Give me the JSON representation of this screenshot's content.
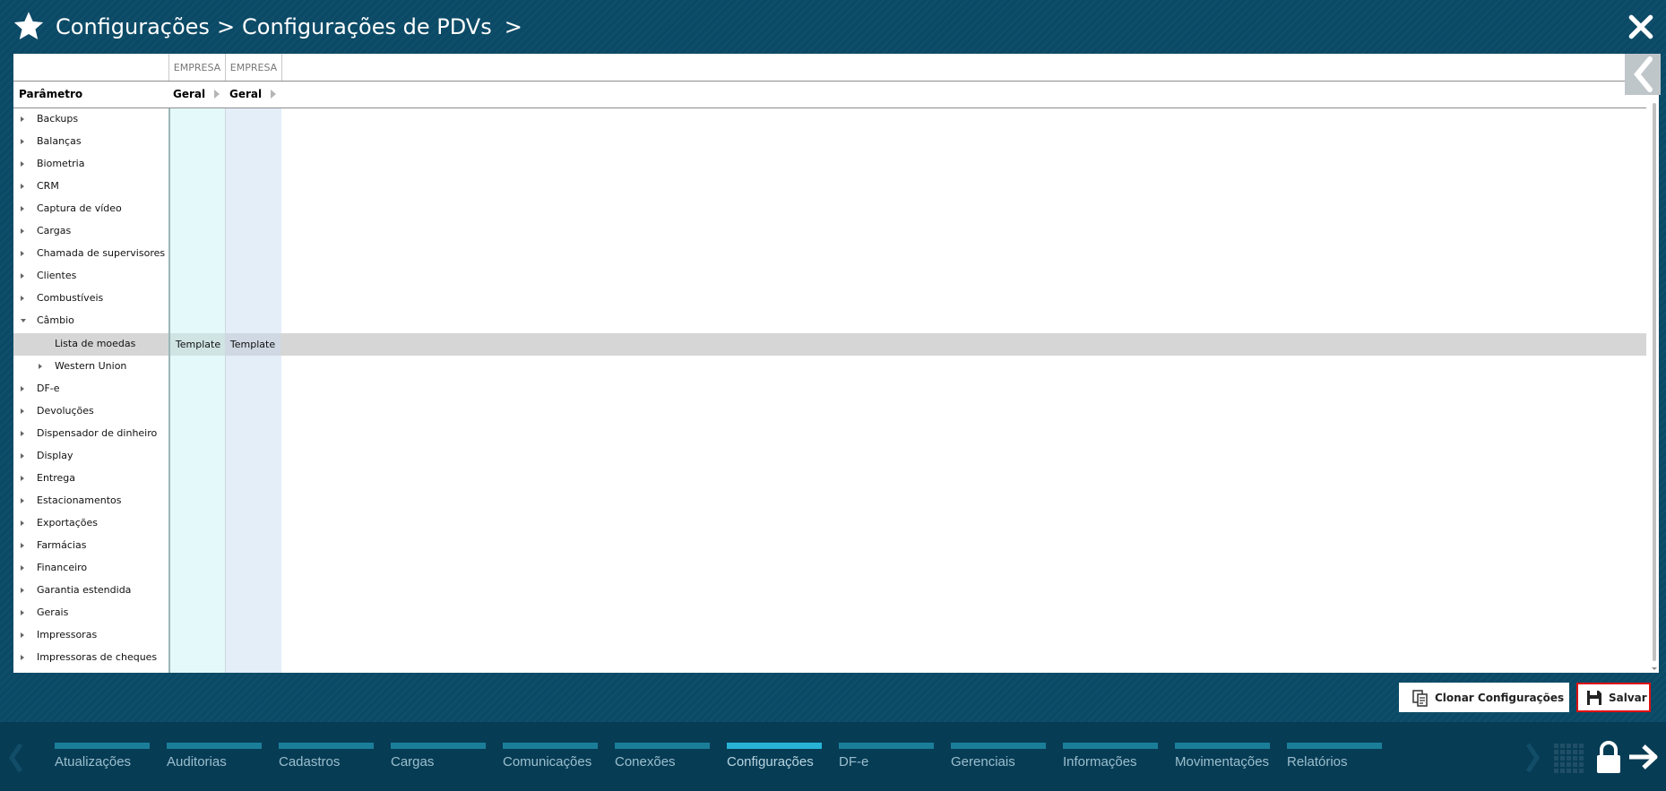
{
  "header": {
    "breadcrumb": [
      "Configurações",
      "Configurações de PDVs"
    ],
    "separator": ">"
  },
  "grid": {
    "columns": [
      {
        "type": "EMPRESA",
        "name": "Geral"
      },
      {
        "type": "EMPRESA",
        "name": "Geral"
      }
    ],
    "param_header": "Parâmetro",
    "rows": [
      {
        "label": "Backups",
        "level": 0,
        "state": "collapsed"
      },
      {
        "label": "Balanças",
        "level": 0,
        "state": "collapsed"
      },
      {
        "label": "Biometria",
        "level": 0,
        "state": "collapsed"
      },
      {
        "label": "CRM",
        "level": 0,
        "state": "collapsed"
      },
      {
        "label": "Captura de vídeo",
        "level": 0,
        "state": "collapsed"
      },
      {
        "label": "Cargas",
        "level": 0,
        "state": "collapsed"
      },
      {
        "label": "Chamada de supervisores",
        "level": 0,
        "state": "collapsed"
      },
      {
        "label": "Clientes",
        "level": 0,
        "state": "collapsed"
      },
      {
        "label": "Combustíveis",
        "level": 0,
        "state": "collapsed"
      },
      {
        "label": "Câmbio",
        "level": 0,
        "state": "expanded"
      },
      {
        "label": "Lista de moedas",
        "level": 1,
        "state": "leaf",
        "selected": true,
        "values": [
          "Template",
          "Template"
        ]
      },
      {
        "label": "Western Union",
        "level": 1,
        "state": "collapsed"
      },
      {
        "label": "DF-e",
        "level": 0,
        "state": "collapsed"
      },
      {
        "label": "Devoluções",
        "level": 0,
        "state": "collapsed"
      },
      {
        "label": "Dispensador de dinheiro",
        "level": 0,
        "state": "collapsed"
      },
      {
        "label": "Display",
        "level": 0,
        "state": "collapsed"
      },
      {
        "label": "Entrega",
        "level": 0,
        "state": "collapsed"
      },
      {
        "label": "Estacionamentos",
        "level": 0,
        "state": "collapsed"
      },
      {
        "label": "Exportações",
        "level": 0,
        "state": "collapsed"
      },
      {
        "label": "Farmácias",
        "level": 0,
        "state": "collapsed"
      },
      {
        "label": "Financeiro",
        "level": 0,
        "state": "collapsed"
      },
      {
        "label": "Garantia estendida",
        "level": 0,
        "state": "collapsed"
      },
      {
        "label": "Gerais",
        "level": 0,
        "state": "collapsed"
      },
      {
        "label": "Impressoras",
        "level": 0,
        "state": "collapsed"
      },
      {
        "label": "Impressoras de cheques",
        "level": 0,
        "state": "collapsed"
      }
    ]
  },
  "actions": {
    "clone_label": "Clonar Configurações",
    "save_label": "Salvar"
  },
  "bottom_nav": {
    "items": [
      "Atualizações",
      "Auditorias",
      "Cadastros",
      "Cargas",
      "Comunicações",
      "Conexões",
      "Configurações",
      "DF-e",
      "Gerenciais",
      "Informações",
      "Movimentações",
      "Relatórios"
    ],
    "active": "Configurações"
  },
  "colors": {
    "background": "#0b4a66",
    "bottom_bar": "#073c55",
    "nav_bar": "#1b7e99",
    "nav_bar_active": "#28b2d5",
    "selected_row": "#d6d6d6",
    "column1_bg": "#e4f9fa",
    "column2_bg": "#e4eef9",
    "save_border": "#dd1111"
  },
  "icons": [
    "star-icon",
    "close-icon",
    "chevron-left-icon",
    "clone-icon",
    "save-icon",
    "apps-grid-icon",
    "lock-icon",
    "exit-arrow-icon"
  ]
}
